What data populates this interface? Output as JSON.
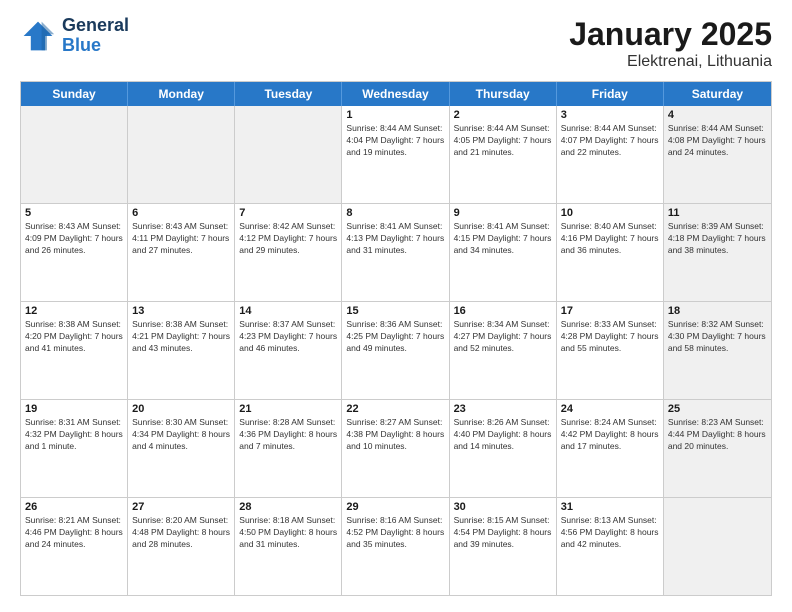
{
  "logo": {
    "line1": "General",
    "line2": "Blue"
  },
  "title": "January 2025",
  "location": "Elektrenai, Lithuania",
  "days_of_week": [
    "Sunday",
    "Monday",
    "Tuesday",
    "Wednesday",
    "Thursday",
    "Friday",
    "Saturday"
  ],
  "weeks": [
    [
      {
        "day": "",
        "info": "",
        "shaded": true
      },
      {
        "day": "",
        "info": "",
        "shaded": true
      },
      {
        "day": "",
        "info": "",
        "shaded": true
      },
      {
        "day": "1",
        "info": "Sunrise: 8:44 AM\nSunset: 4:04 PM\nDaylight: 7 hours\nand 19 minutes.",
        "shaded": false
      },
      {
        "day": "2",
        "info": "Sunrise: 8:44 AM\nSunset: 4:05 PM\nDaylight: 7 hours\nand 21 minutes.",
        "shaded": false
      },
      {
        "day": "3",
        "info": "Sunrise: 8:44 AM\nSunset: 4:07 PM\nDaylight: 7 hours\nand 22 minutes.",
        "shaded": false
      },
      {
        "day": "4",
        "info": "Sunrise: 8:44 AM\nSunset: 4:08 PM\nDaylight: 7 hours\nand 24 minutes.",
        "shaded": true
      }
    ],
    [
      {
        "day": "5",
        "info": "Sunrise: 8:43 AM\nSunset: 4:09 PM\nDaylight: 7 hours\nand 26 minutes.",
        "shaded": false
      },
      {
        "day": "6",
        "info": "Sunrise: 8:43 AM\nSunset: 4:11 PM\nDaylight: 7 hours\nand 27 minutes.",
        "shaded": false
      },
      {
        "day": "7",
        "info": "Sunrise: 8:42 AM\nSunset: 4:12 PM\nDaylight: 7 hours\nand 29 minutes.",
        "shaded": false
      },
      {
        "day": "8",
        "info": "Sunrise: 8:41 AM\nSunset: 4:13 PM\nDaylight: 7 hours\nand 31 minutes.",
        "shaded": false
      },
      {
        "day": "9",
        "info": "Sunrise: 8:41 AM\nSunset: 4:15 PM\nDaylight: 7 hours\nand 34 minutes.",
        "shaded": false
      },
      {
        "day": "10",
        "info": "Sunrise: 8:40 AM\nSunset: 4:16 PM\nDaylight: 7 hours\nand 36 minutes.",
        "shaded": false
      },
      {
        "day": "11",
        "info": "Sunrise: 8:39 AM\nSunset: 4:18 PM\nDaylight: 7 hours\nand 38 minutes.",
        "shaded": true
      }
    ],
    [
      {
        "day": "12",
        "info": "Sunrise: 8:38 AM\nSunset: 4:20 PM\nDaylight: 7 hours\nand 41 minutes.",
        "shaded": false
      },
      {
        "day": "13",
        "info": "Sunrise: 8:38 AM\nSunset: 4:21 PM\nDaylight: 7 hours\nand 43 minutes.",
        "shaded": false
      },
      {
        "day": "14",
        "info": "Sunrise: 8:37 AM\nSunset: 4:23 PM\nDaylight: 7 hours\nand 46 minutes.",
        "shaded": false
      },
      {
        "day": "15",
        "info": "Sunrise: 8:36 AM\nSunset: 4:25 PM\nDaylight: 7 hours\nand 49 minutes.",
        "shaded": false
      },
      {
        "day": "16",
        "info": "Sunrise: 8:34 AM\nSunset: 4:27 PM\nDaylight: 7 hours\nand 52 minutes.",
        "shaded": false
      },
      {
        "day": "17",
        "info": "Sunrise: 8:33 AM\nSunset: 4:28 PM\nDaylight: 7 hours\nand 55 minutes.",
        "shaded": false
      },
      {
        "day": "18",
        "info": "Sunrise: 8:32 AM\nSunset: 4:30 PM\nDaylight: 7 hours\nand 58 minutes.",
        "shaded": true
      }
    ],
    [
      {
        "day": "19",
        "info": "Sunrise: 8:31 AM\nSunset: 4:32 PM\nDaylight: 8 hours\nand 1 minute.",
        "shaded": false
      },
      {
        "day": "20",
        "info": "Sunrise: 8:30 AM\nSunset: 4:34 PM\nDaylight: 8 hours\nand 4 minutes.",
        "shaded": false
      },
      {
        "day": "21",
        "info": "Sunrise: 8:28 AM\nSunset: 4:36 PM\nDaylight: 8 hours\nand 7 minutes.",
        "shaded": false
      },
      {
        "day": "22",
        "info": "Sunrise: 8:27 AM\nSunset: 4:38 PM\nDaylight: 8 hours\nand 10 minutes.",
        "shaded": false
      },
      {
        "day": "23",
        "info": "Sunrise: 8:26 AM\nSunset: 4:40 PM\nDaylight: 8 hours\nand 14 minutes.",
        "shaded": false
      },
      {
        "day": "24",
        "info": "Sunrise: 8:24 AM\nSunset: 4:42 PM\nDaylight: 8 hours\nand 17 minutes.",
        "shaded": false
      },
      {
        "day": "25",
        "info": "Sunrise: 8:23 AM\nSunset: 4:44 PM\nDaylight: 8 hours\nand 20 minutes.",
        "shaded": true
      }
    ],
    [
      {
        "day": "26",
        "info": "Sunrise: 8:21 AM\nSunset: 4:46 PM\nDaylight: 8 hours\nand 24 minutes.",
        "shaded": false
      },
      {
        "day": "27",
        "info": "Sunrise: 8:20 AM\nSunset: 4:48 PM\nDaylight: 8 hours\nand 28 minutes.",
        "shaded": false
      },
      {
        "day": "28",
        "info": "Sunrise: 8:18 AM\nSunset: 4:50 PM\nDaylight: 8 hours\nand 31 minutes.",
        "shaded": false
      },
      {
        "day": "29",
        "info": "Sunrise: 8:16 AM\nSunset: 4:52 PM\nDaylight: 8 hours\nand 35 minutes.",
        "shaded": false
      },
      {
        "day": "30",
        "info": "Sunrise: 8:15 AM\nSunset: 4:54 PM\nDaylight: 8 hours\nand 39 minutes.",
        "shaded": false
      },
      {
        "day": "31",
        "info": "Sunrise: 8:13 AM\nSunset: 4:56 PM\nDaylight: 8 hours\nand 42 minutes.",
        "shaded": false
      },
      {
        "day": "",
        "info": "",
        "shaded": true
      }
    ]
  ]
}
